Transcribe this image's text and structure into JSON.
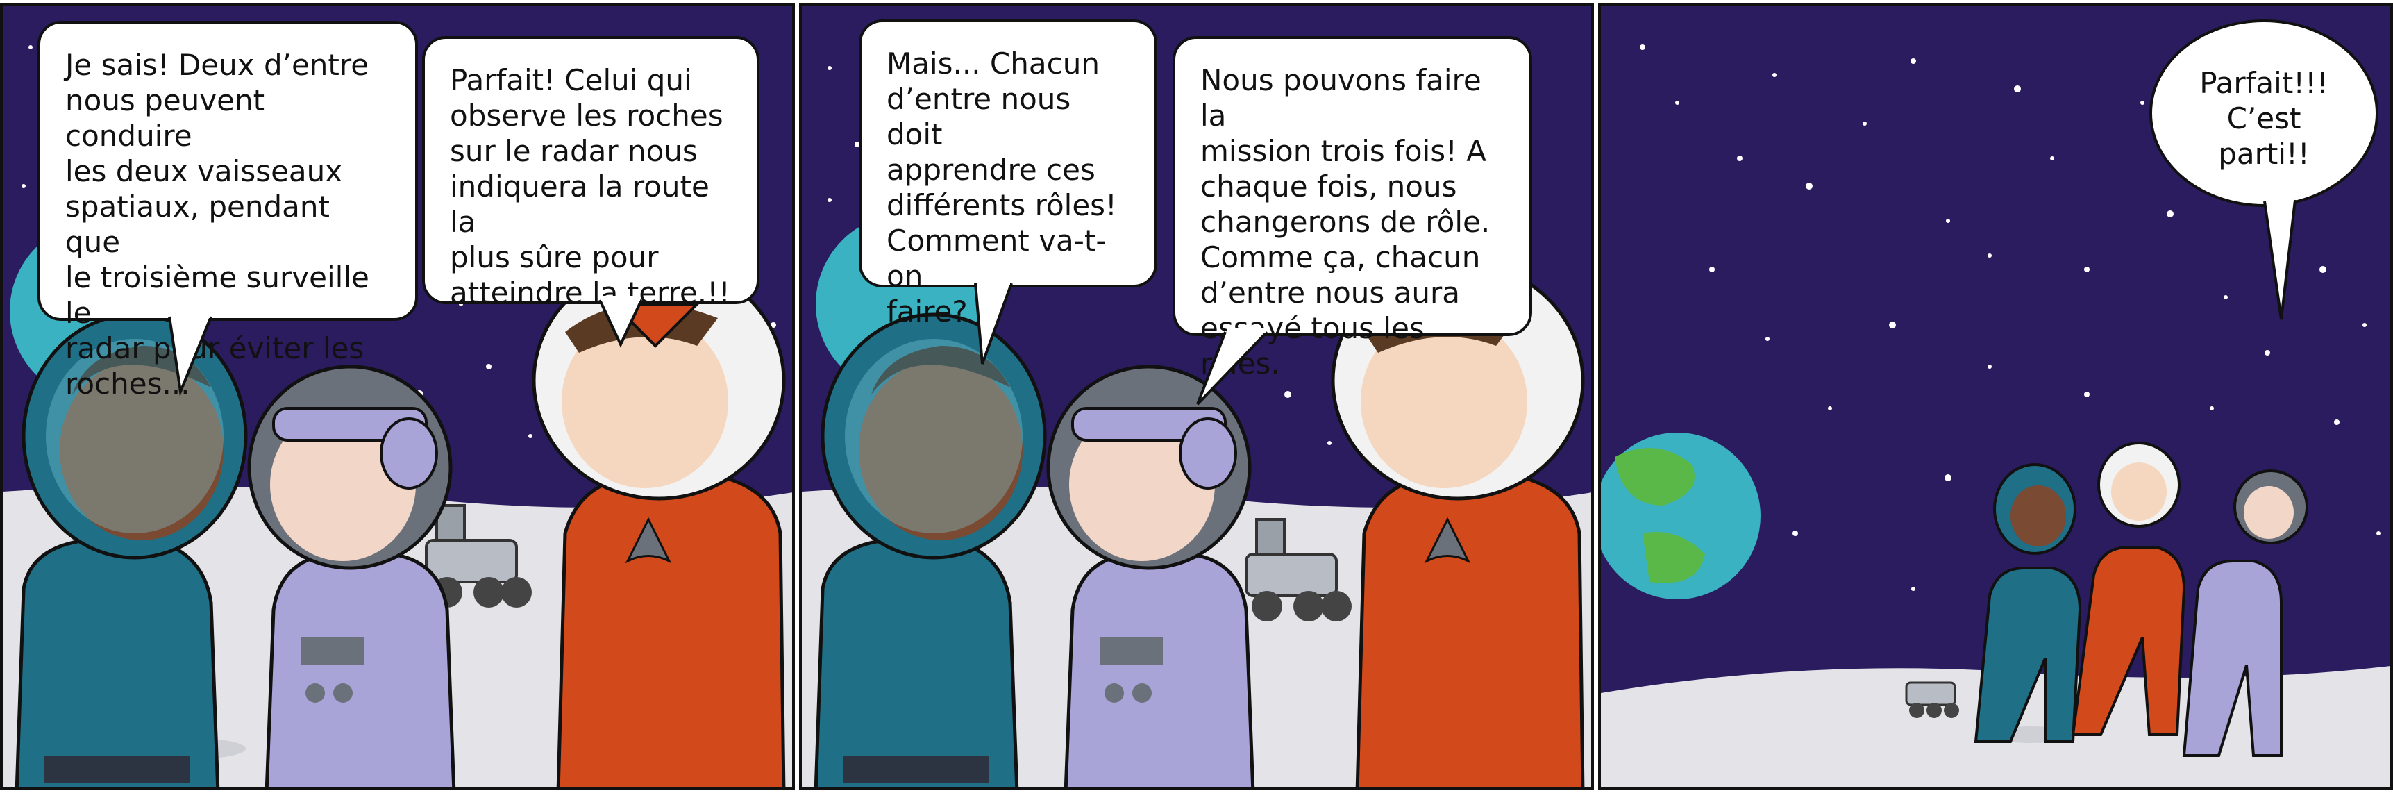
{
  "colors": {
    "sky": "#2a1c5e",
    "ground": "#e4e4e8",
    "earth_ocean": "#3ab2c2",
    "earth_land": "#59b848",
    "teal_suit": "#1f6f86",
    "lavender_suit": "#a9a4d8",
    "orange_suit": "#d24a1c",
    "white_helmet": "#f2f2f2",
    "grey_helmet": "#6b717a"
  },
  "panels": [
    {
      "bubbles": [
        {
          "speaker": "teal-astronaut",
          "text": "Je sais! Deux d’entre\nnous peuvent conduire\nles deux vaisseaux\nspatiaux, pendant que\nle troisième surveille le\nradar pour éviter les\nroches..."
        },
        {
          "speaker": "orange-astronaut",
          "text": "Parfait! Celui qui\nobserve les roches\nsur le radar nous\nindiquera la route la\nplus sûre pour\natteindre la terre.!!"
        }
      ]
    },
    {
      "bubbles": [
        {
          "speaker": "teal-astronaut",
          "text": "Mais... Chacun\nd’entre nous doit\napprendre ces\ndifférents rôles!\nComment va-t-on\nfaire?"
        },
        {
          "speaker": "lavender-astronaut",
          "text": "Nous pouvons faire la\nmission trois fois! A\nchaque fois, nous\nchangerons de rôle.\nComme ça, chacun\nd’entre nous aura\nessayé tous les rôles."
        }
      ]
    },
    {
      "bubbles": [
        {
          "speaker": "group",
          "text": "Parfait!!!\nC’est\nparti!!"
        }
      ]
    }
  ]
}
